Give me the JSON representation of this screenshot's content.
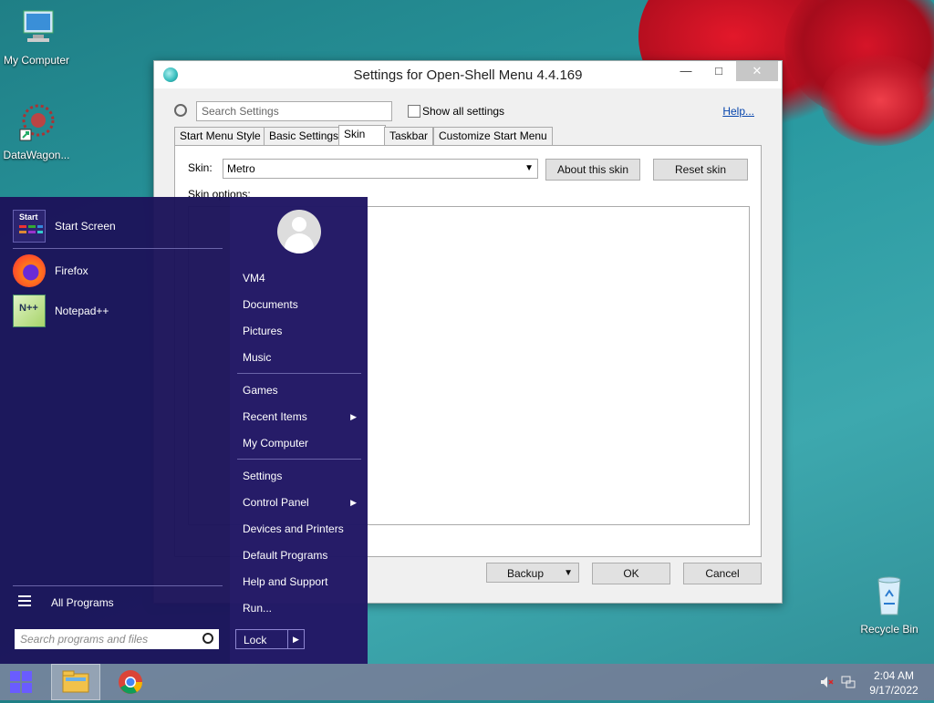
{
  "desktop": {
    "icons": [
      {
        "label": "My Computer",
        "icon": "computer-icon"
      },
      {
        "label": "DataWagon...",
        "icon": "datawagon-icon"
      },
      {
        "label": "Recycle Bin",
        "icon": "recycle-bin-icon"
      }
    ]
  },
  "window": {
    "title": "Settings for Open-Shell Menu 4.4.169",
    "search_placeholder": "Search Settings",
    "show_all_label": "Show all settings",
    "help_label": "Help...",
    "tabs": [
      {
        "label": "Start Menu Style"
      },
      {
        "label": "Basic Settings"
      },
      {
        "label": "Skin",
        "active": true
      },
      {
        "label": "Taskbar"
      },
      {
        "label": "Customize Start Menu"
      }
    ],
    "skin_label": "Skin:",
    "skin_value": "Metro",
    "about_skin_label": "About this skin",
    "reset_skin_label": "Reset skin",
    "skin_options_label": "Skin options:",
    "backup_label": "Backup",
    "ok_label": "OK",
    "cancel_label": "Cancel"
  },
  "start_menu": {
    "programs": [
      {
        "label": "Start Screen",
        "icon": "start-screen-icon"
      },
      {
        "label": "Firefox",
        "icon": "firefox-icon"
      },
      {
        "label": "Notepad++",
        "icon": "notepadpp-icon"
      }
    ],
    "all_programs_label": "All Programs",
    "search_placeholder": "Search programs and files",
    "right_items": [
      {
        "label": "VM4"
      },
      {
        "label": "Documents"
      },
      {
        "label": "Pictures"
      },
      {
        "label": "Music"
      },
      {
        "label": "Games"
      },
      {
        "label": "Recent Items",
        "submenu": true
      },
      {
        "label": "My Computer"
      },
      {
        "label": "Settings"
      },
      {
        "label": "Control Panel",
        "submenu": true
      },
      {
        "label": "Devices and Printers"
      },
      {
        "label": "Default Programs"
      },
      {
        "label": "Help and Support"
      },
      {
        "label": "Run..."
      }
    ],
    "lock_label": "Lock"
  },
  "taskbar": {
    "time": "2:04 AM",
    "date": "9/17/2022"
  },
  "colors": {
    "start_menu_bg": "#1c145a",
    "desktop_bg": "#2a9aa1"
  }
}
